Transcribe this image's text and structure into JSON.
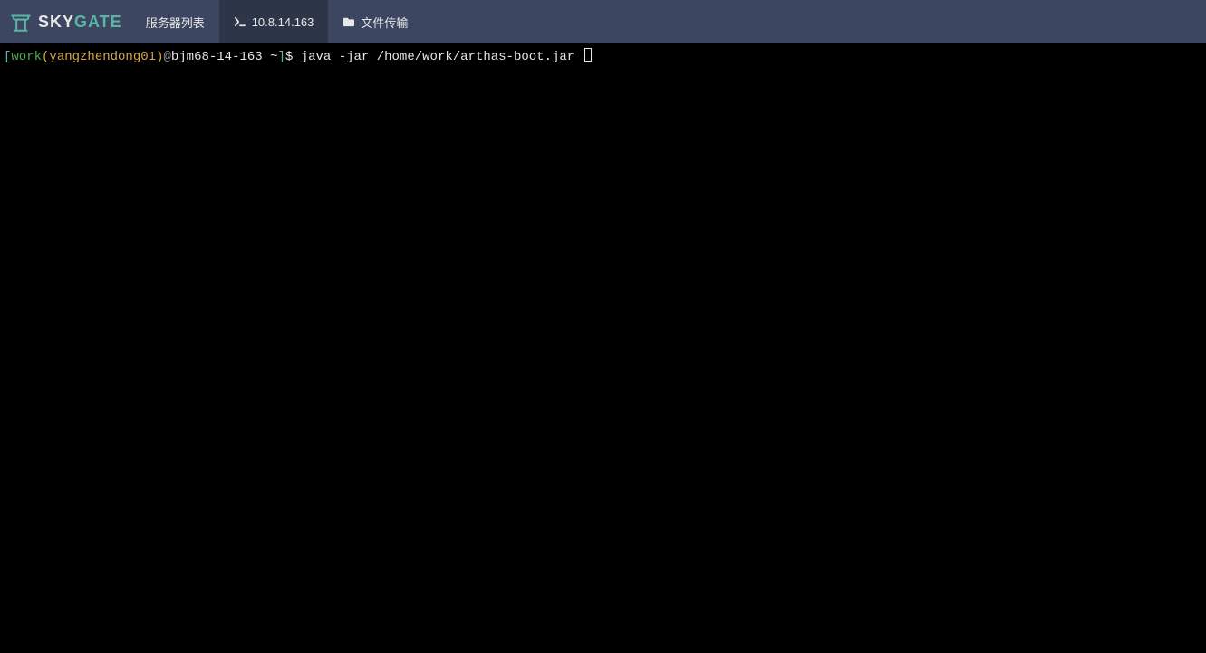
{
  "logo": {
    "part1": "SKY",
    "part2": "GATE"
  },
  "nav": {
    "server_list": "服务器列表",
    "terminal_ip": "10.8.14.163",
    "file_transfer": "文件传输"
  },
  "terminal": {
    "bracket_open": "[",
    "user1": "work",
    "paren_open": "(",
    "user2": "yangzhendong01",
    "paren_close": ")",
    "at": "@",
    "host": "bjm68-14-163",
    "path": " ~",
    "bracket_close": "]",
    "dollar": "$ ",
    "command": "java -jar /home/work/arthas-boot.jar "
  }
}
